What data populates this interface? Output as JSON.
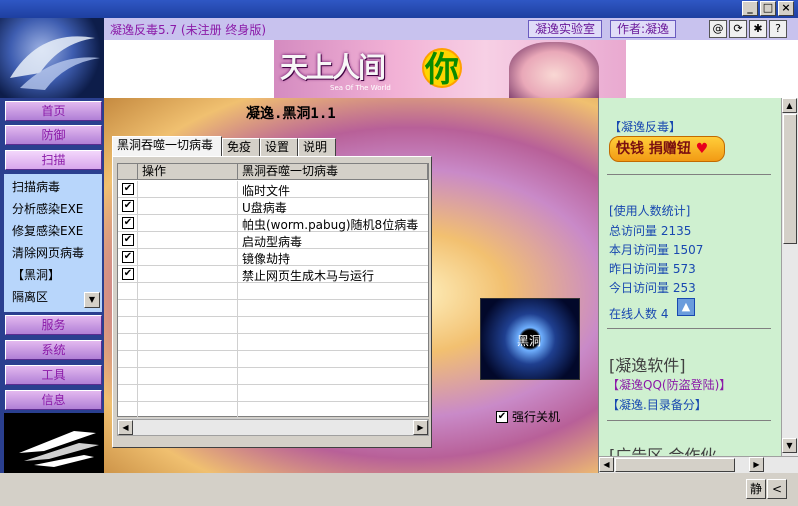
{
  "window": {
    "min_glyph": "_",
    "max_glyph": "□",
    "close_glyph": "×"
  },
  "top": {
    "app_title": "凝逸反毒5.7  (未注册 终身版)",
    "lab_button": "凝逸实验室",
    "author_button": "作者:凝逸",
    "icons": [
      {
        "name": "at-icon",
        "glyph": "@"
      },
      {
        "name": "refresh-icon",
        "glyph": "⟳"
      },
      {
        "name": "gear-icon",
        "glyph": "✱"
      },
      {
        "name": "help-icon",
        "glyph": "?"
      }
    ]
  },
  "banner": {
    "title_ch": "天上人间",
    "subtitle_en": "Sea Of The World",
    "big_char": "你"
  },
  "nav": {
    "buttons": [
      "首页",
      "防御",
      "扫描",
      "服务",
      "系统",
      "工具",
      "信息"
    ],
    "active": "扫描",
    "submenu": [
      "扫描病毒",
      "分析感染EXE",
      "修复感染EXE",
      "清除网页病毒",
      "【黑洞】",
      "隔离区"
    ]
  },
  "main": {
    "title": "凝逸.黑洞1.1",
    "tabs": [
      "黑洞吞噬一切病毒",
      "免疫",
      "设置",
      "说明"
    ],
    "active_tab": "黑洞吞噬一切病毒",
    "columns": [
      "操作",
      "黑洞吞噬一切病毒"
    ],
    "rows": [
      {
        "checked": true,
        "text": "临时文件"
      },
      {
        "checked": true,
        "text": "U盘病毒"
      },
      {
        "checked": true,
        "text": "帕虫(worm.pabug)随机8位病毒"
      },
      {
        "checked": true,
        "text": "启动型病毒"
      },
      {
        "checked": true,
        "text": "镜像劫持"
      },
      {
        "checked": true,
        "text": "禁止网页生成木马与运行"
      }
    ],
    "blackhole_label": "黑洞",
    "force_shutdown": {
      "label": "强行关机",
      "checked": true
    }
  },
  "right": {
    "brand": "【凝逸反毒】",
    "donate": "快钱 捐赠钮",
    "stats_title": "[使用人数统计]",
    "stats": [
      {
        "label": "总访问量",
        "value": "2135"
      },
      {
        "label": "本月访问量",
        "value": "1507"
      },
      {
        "label": "昨日访问量",
        "value": "573"
      },
      {
        "label": "今日访问量",
        "value": "253"
      }
    ],
    "online": {
      "label": "在线人数",
      "value": "4"
    },
    "software_title": "[凝逸软件]",
    "software": [
      "【凝逸QQ(防盗登陆)】",
      "【凝逸.目录备分】"
    ],
    "ad_title": "[广告区 合作伙"
  },
  "bottom": {
    "static_button": "静",
    "back_button": "<"
  }
}
